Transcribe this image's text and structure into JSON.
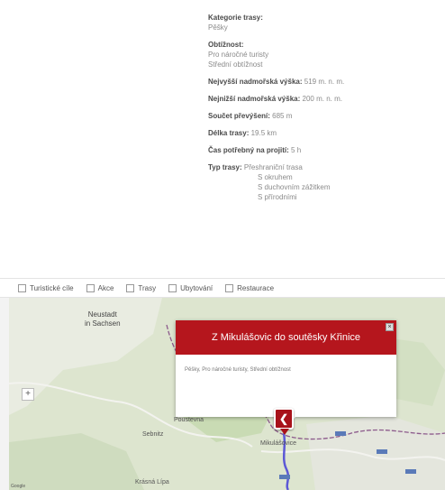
{
  "info": {
    "category_label": "Kategorie trasy:",
    "category_value": "Pěšky",
    "difficulty_label": "Obtížnost:",
    "difficulty_values": [
      "Pro náročné turisty",
      "Střední obtížnost"
    ],
    "max_alt_label": "Nejvyšší nadmořská výška:",
    "max_alt_value": "519 m. n. m.",
    "min_alt_label": "Nejnižší nadmořská výška:",
    "min_alt_value": "200 m. n. m.",
    "elev_sum_label": "Součet převýšení:",
    "elev_sum_value": "685 m",
    "length_label": "Délka trasy:",
    "length_value": "19.5 km",
    "time_label": "Čas potřebný na projití:",
    "time_value": "5 h",
    "type_label": "Typ trasy:",
    "type_first": "Přeshraniční trasa",
    "type_rest": [
      "S okruhem",
      "S duchovním zážitkem",
      "S přírodními"
    ]
  },
  "filters": [
    {
      "label": "Turistické cíle"
    },
    {
      "label": "Akce"
    },
    {
      "label": "Trasy"
    },
    {
      "label": "Ubytování"
    },
    {
      "label": "Restaurace"
    }
  ],
  "map": {
    "popup_title": "Z Mikulášovic do soutěsky Křinice",
    "popup_body": "Pěšky, Pro náročné turisty, Střední obtížnost",
    "close_symbol": "×",
    "zoom_symbol": "+",
    "marker_symbol": "❮",
    "towns": {
      "neustadt": "Neustadt\nin Sachsen",
      "town_a": "Dolní\nPoustevna",
      "town_b": "Sebnitz",
      "town_c": "Mikulášovice",
      "town_d": "Krásná Lípa"
    },
    "attribution": "Google"
  },
  "colors": {
    "accent": "#b5161d",
    "route": "#5c58d6",
    "border_line": "#8c5a8c"
  }
}
